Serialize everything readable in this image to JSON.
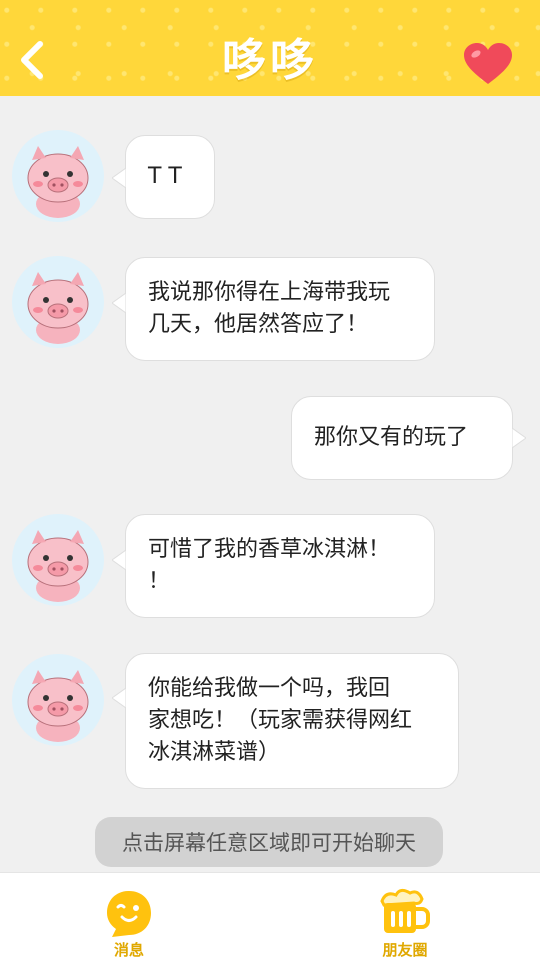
{
  "header": {
    "title": "哆哆",
    "back_icon": "chevron-left-icon",
    "favorite_icon": "heart-icon",
    "accent": "#ffd73a",
    "heart_color": "#f04a5a"
  },
  "messages": [
    {
      "from": "contact",
      "text": "T T"
    },
    {
      "from": "contact",
      "text": "我说那你得在上海带我玩\n几天，他居然答应了！"
    },
    {
      "from": "me",
      "text": "那你又有的玩了"
    },
    {
      "from": "contact",
      "text": "可惜了我的香草冰淇淋！\n！"
    },
    {
      "from": "contact",
      "text": "你能给我做一个吗，我回\n家想吃！（玩家需获得网红\n冰淇淋菜谱）"
    }
  ],
  "hint": "点击屏幕任意区域即可开始聊天",
  "tabs": [
    {
      "label": "消息",
      "icon": "smiley-bubble-icon"
    },
    {
      "label": "朋友圈",
      "icon": "beer-mug-icon"
    }
  ]
}
